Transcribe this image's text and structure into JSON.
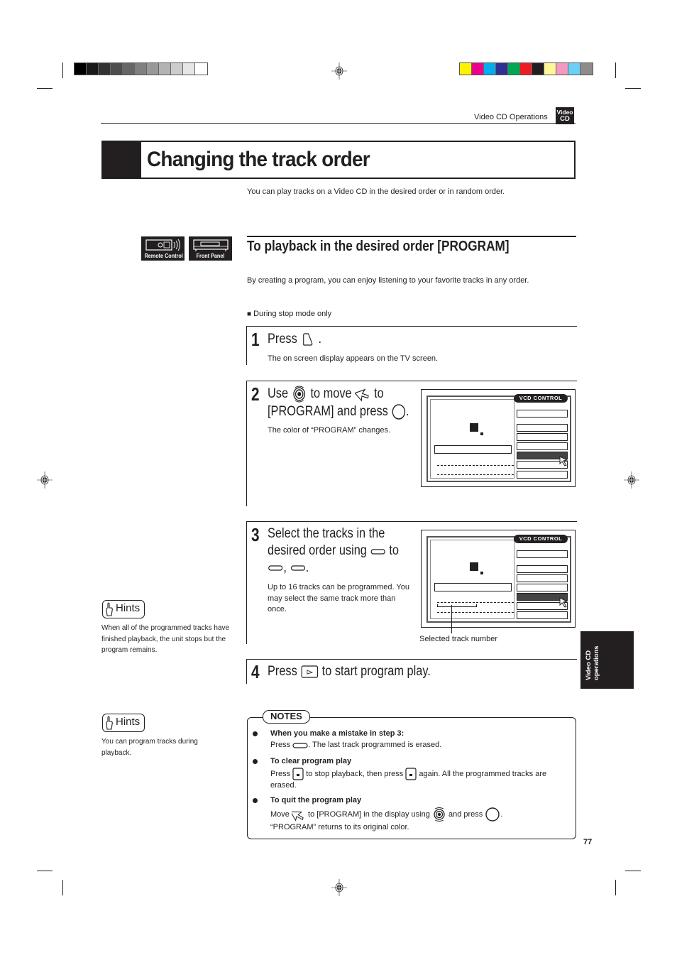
{
  "color_bars": {
    "grayscale": [
      "#000000",
      "#1a1a1a",
      "#333333",
      "#4d4d4d",
      "#666666",
      "#808080",
      "#999999",
      "#b3b3b3",
      "#cccccc",
      "#e6e6e6",
      "#ffffff"
    ],
    "process": [
      "#fff200",
      "#ec008c",
      "#00aeef",
      "#2e3192",
      "#00a651",
      "#ed1c24",
      "#231f20",
      "#fff799",
      "#f49ac1",
      "#6dcff6",
      "#8c8c8c"
    ]
  },
  "header": {
    "section": "Video CD Operations",
    "badge_line1": "Video",
    "badge_line2": "CD"
  },
  "title": "Changing the track order",
  "intro": "You can play tracks on a Video CD in the desired order or in random order.",
  "device_icons": {
    "remote": "Remote Control",
    "front": "Front Panel"
  },
  "section": {
    "title": "To playback in the desired order [PROGRAM]",
    "description": "By creating a program, you can enjoy listening to your favorite tracks in any order.",
    "condition_marker": "■",
    "condition": "During stop mode only"
  },
  "steps": [
    {
      "number": "1",
      "head_a": "Press",
      "head_b": ".",
      "sub": "The on screen display appears on the TV screen."
    },
    {
      "number": "2",
      "head_a": "Use",
      "head_b": "to move",
      "head_c": "to",
      "head_d": "[PROGRAM] and press",
      "head_e": ".",
      "sub": "The color of “PROGRAM” changes."
    },
    {
      "number": "3",
      "head_a": "Select the tracks in the",
      "head_b": "desired order using",
      "head_c": "to",
      "head_d": ",",
      "head_e": ".",
      "sub": "Up to 16 tracks can be programmed. You may select the same track more than once."
    },
    {
      "number": "4",
      "head_a": "Press",
      "head_b": "to start program play."
    }
  ],
  "osd": {
    "badge": "VCD CONTROL",
    "callout": "Selected track number"
  },
  "hints": [
    {
      "label": "Hints",
      "text": "When all of the programmed tracks have finished playback, the unit stops but the program remains."
    },
    {
      "label": "Hints",
      "text": "You can program tracks during playback."
    }
  ],
  "side_tab": {
    "line1": "Video CD",
    "line2": "operations"
  },
  "notes": {
    "label": "NOTES",
    "items": [
      {
        "title": "When you make a mistake in step 3:",
        "a": "Press",
        "b": ". The last track programmed is erased."
      },
      {
        "title": "To clear program play",
        "a": "Press",
        "b": "to stop playback, then press",
        "c": "again.  All the programmed tracks are erased."
      },
      {
        "title": "To quit the program play",
        "a": "Move",
        "b": "to [PROGRAM] in the display using",
        "c": "and press",
        "d": ".",
        "e": "“PROGRAM” returns to its original color."
      }
    ]
  },
  "page_number": "77"
}
